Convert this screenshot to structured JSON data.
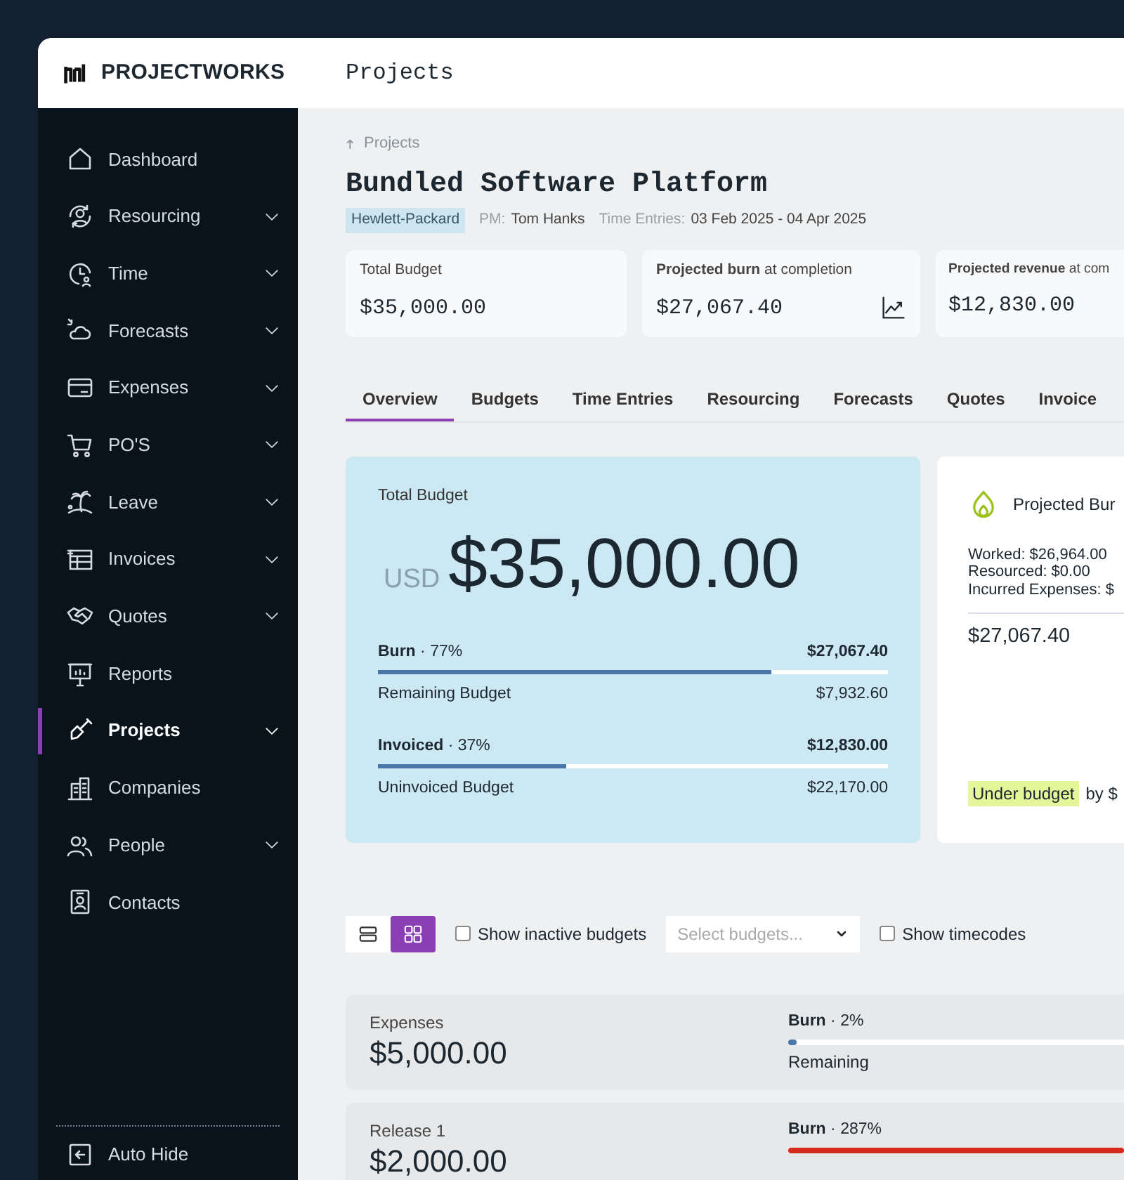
{
  "brand": {
    "name": "PROJECTWORKS"
  },
  "header": {
    "title": "Projects"
  },
  "sidebar": {
    "items": [
      {
        "label": "Dashboard",
        "expandable": false,
        "selected": false
      },
      {
        "label": "Resourcing",
        "expandable": true,
        "selected": false
      },
      {
        "label": "Time",
        "expandable": true,
        "selected": false
      },
      {
        "label": "Forecasts",
        "expandable": true,
        "selected": false
      },
      {
        "label": "Expenses",
        "expandable": true,
        "selected": false
      },
      {
        "label": "PO'S",
        "expandable": true,
        "selected": false
      },
      {
        "label": "Leave",
        "expandable": true,
        "selected": false
      },
      {
        "label": "Invoices",
        "expandable": true,
        "selected": false
      },
      {
        "label": "Quotes",
        "expandable": true,
        "selected": false
      },
      {
        "label": "Reports",
        "expandable": false,
        "selected": false
      },
      {
        "label": "Projects",
        "expandable": true,
        "selected": true
      },
      {
        "label": "Companies",
        "expandable": false,
        "selected": false
      },
      {
        "label": "People",
        "expandable": true,
        "selected": false
      },
      {
        "label": "Contacts",
        "expandable": false,
        "selected": false
      }
    ],
    "footer": {
      "label": "Auto Hide"
    }
  },
  "breadcrumb": {
    "label": "Projects"
  },
  "project": {
    "title": "Bundled Software Platform",
    "client": "Hewlett-Packard",
    "pm_label": "PM:",
    "pm": "Tom Hanks",
    "time_label": "Time Entries:",
    "time_range": "03 Feb 2025 - 04 Apr 2025"
  },
  "stats": [
    {
      "label": "Total Budget",
      "value": "$35,000.00"
    },
    {
      "label": "**Projected burn** at completion",
      "value": "$27,067.40",
      "trend": true
    },
    {
      "label": "**Projected revenue** at com",
      "value": "$12,830.00"
    }
  ],
  "tabs": [
    {
      "label": "Overview",
      "selected": true
    },
    {
      "label": "Budgets",
      "selected": false
    },
    {
      "label": "Time Entries",
      "selected": false
    },
    {
      "label": "Resourcing",
      "selected": false
    },
    {
      "label": "Forecasts",
      "selected": false
    },
    {
      "label": "Quotes",
      "selected": false
    },
    {
      "label": "Invoice",
      "selected": false
    }
  ],
  "total_budget": {
    "label": "Total Budget",
    "currency": "USD",
    "amount": "$35,000.00",
    "bars": [
      {
        "label": "**Burn** · 77%",
        "amount": "$27,067.40",
        "level": 0.77,
        "sub_label": "Remaining Budget",
        "sub_amount": "$7,932.60"
      },
      {
        "label": "**Invoiced** · 37%",
        "amount": "$12,830.00",
        "level": 0.37,
        "sub_label": "Uninvoiced Budget",
        "sub_amount": "$22,170.00"
      }
    ]
  },
  "projected": {
    "title": "Projected Bur",
    "lines": [
      "Worked: $26,964.00",
      "Resourced: $0.00",
      "Incurred Expenses: $"
    ],
    "total": "$27,067.40",
    "status": "Under budget",
    "status_suffix": "by $"
  },
  "toolbar": {
    "views": [
      {
        "kind": "list",
        "selected": false
      },
      {
        "kind": "grid",
        "selected": true
      }
    ],
    "show_inactive": {
      "label": "Show inactive budgets",
      "checked": false
    },
    "select": {
      "placeholder": "Select budgets..."
    },
    "show_timecodes": {
      "label": "Show timecodes",
      "checked": false
    }
  },
  "budgets": [
    {
      "name": "Expenses",
      "amount": "$5,000.00",
      "burn": "**Burn** · 2%",
      "level": 0.02,
      "color": "#4a77a8",
      "remaining": "Remaining"
    },
    {
      "name": "Release 1",
      "amount": "$2,000.00",
      "burn": "**Burn** · 287%",
      "level": 1,
      "color": "#d9281c"
    }
  ]
}
